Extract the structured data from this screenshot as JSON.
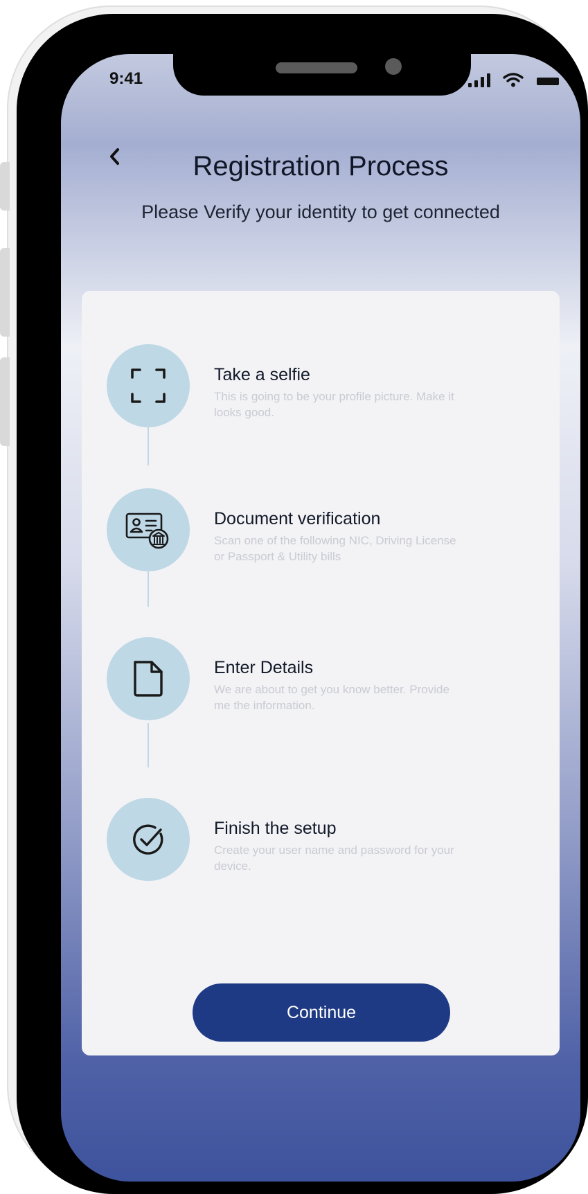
{
  "status_bar": {
    "time": "9:41",
    "signal_icon": "cellular-signal-icon",
    "wifi_icon": "wifi-icon",
    "battery_icon": "battery-icon"
  },
  "header": {
    "back_icon": "chevron-left-icon",
    "title": "Registration Process",
    "subtitle": "Please Verify your identity to get connected"
  },
  "steps": [
    {
      "icon": "scan-frame-icon",
      "title": "Take a selfie",
      "description": "This is going to be your profile picture. Make it looks good."
    },
    {
      "icon": "id-document-icon",
      "title": "Document verification",
      "description": "Scan one of the following NIC, Driving License or Passport & Utility bills"
    },
    {
      "icon": "file-icon",
      "title": "Enter Details",
      "description": "We are about to get you know better. Provide me the information."
    },
    {
      "icon": "check-circle-icon",
      "title": "Finish the setup",
      "description": "Create your user name and password for your device."
    }
  ],
  "actions": {
    "continue_label": "Continue"
  },
  "colors": {
    "primary": "#1f3a85",
    "step_circle": "#bed8e6",
    "card_background": "#f3f3f6"
  }
}
